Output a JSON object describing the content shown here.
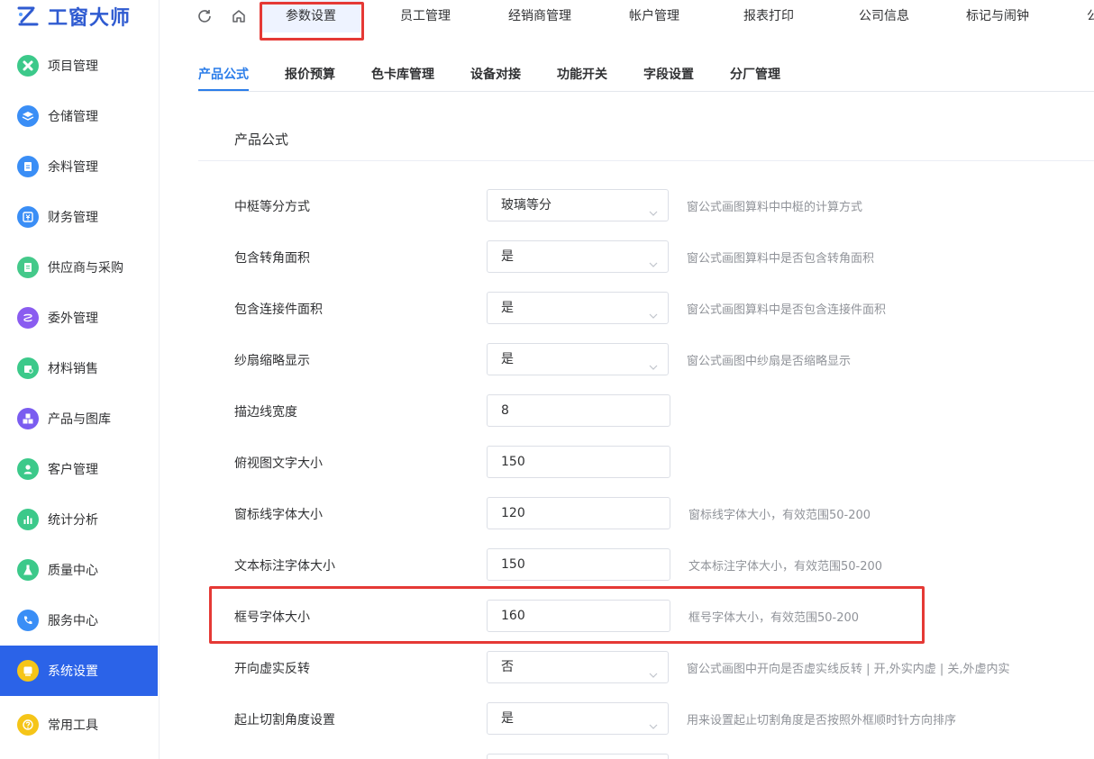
{
  "app": {
    "title": "工窗大师",
    "brand_color": "#2f5bd1",
    "accent_color": "#2b63e8",
    "highlight_color": "#e53935"
  },
  "sidebar": {
    "items": [
      {
        "label": "项目管理",
        "icon": "cross-icon",
        "color": "#3cc98a"
      },
      {
        "label": "仓储管理",
        "icon": "layers-icon",
        "color": "#3a8ef6"
      },
      {
        "label": "余料管理",
        "icon": "document-icon",
        "color": "#3a8ef6"
      },
      {
        "label": "财务管理",
        "icon": "yen-icon",
        "color": "#3a8ef6"
      },
      {
        "label": "供应商与采购",
        "icon": "list-icon",
        "color": "#44c98a"
      },
      {
        "label": "委外管理",
        "icon": "outsource-icon",
        "color": "#8a5cf0"
      },
      {
        "label": "材料销售",
        "icon": "shop-icon",
        "color": "#3cc98a"
      },
      {
        "label": "产品与图库",
        "icon": "boxes-icon",
        "color": "#7a5cf0"
      },
      {
        "label": "客户管理",
        "icon": "user-icon",
        "color": "#3cc98a"
      },
      {
        "label": "统计分析",
        "icon": "bar-chart-icon",
        "color": "#3cc98a"
      },
      {
        "label": "质量中心",
        "icon": "flask-icon",
        "color": "#3cc98a"
      },
      {
        "label": "服务中心",
        "icon": "phone-icon",
        "color": "#3a8ef6"
      },
      {
        "label": "系统设置",
        "icon": "settings-icon",
        "color": "#f5c518",
        "active": true
      },
      {
        "label": "常用工具",
        "icon": "question-icon",
        "color": "#f5c518"
      }
    ]
  },
  "topbar": {
    "refresh_icon": "refresh-icon",
    "home_icon": "home-icon",
    "tabs": [
      "参数设置",
      "员工管理",
      "经销商管理",
      "帐户管理",
      "报表打印",
      "公司信息",
      "标记与闹钟",
      "公"
    ],
    "active_index": 0
  },
  "subtabs": {
    "items": [
      "产品公式",
      "报价预算",
      "色卡库管理",
      "设备对接",
      "功能开关",
      "字段设置",
      "分厂管理"
    ],
    "active_index": 0
  },
  "section": {
    "title": "产品公式"
  },
  "rows": [
    {
      "label": "中梃等分方式",
      "type": "select",
      "value": "玻璃等分",
      "hint": "窗公式画图算料中中梃的计算方式"
    },
    {
      "label": "包含转角面积",
      "type": "select",
      "value": "是",
      "hint": "窗公式画图算料中是否包含转角面积"
    },
    {
      "label": "包含连接件面积",
      "type": "select",
      "value": "是",
      "hint": "窗公式画图算料中是否包含连接件面积"
    },
    {
      "label": "纱扇缩略显示",
      "type": "select",
      "value": "是",
      "hint": "窗公式画图中纱扇是否缩略显示"
    },
    {
      "label": "描边线宽度",
      "type": "input",
      "value": "8",
      "hint": ""
    },
    {
      "label": "俯视图文字大小",
      "type": "input",
      "value": "150",
      "hint": ""
    },
    {
      "label": "窗标线字体大小",
      "type": "input",
      "value": "120",
      "hint": "窗标线字体大小，有效范围50-200"
    },
    {
      "label": "文本标注字体大小",
      "type": "input",
      "value": "150",
      "hint": "文本标注字体大小，有效范围50-200"
    },
    {
      "label": "框号字体大小",
      "type": "input",
      "value": "160",
      "hint": "框号字体大小，有效范围50-200",
      "highlighted": true
    },
    {
      "label": "开向虚实反转",
      "type": "select",
      "value": "否",
      "hint": "窗公式画图中开向是否虚实线反转 | 开,外实内虚 | 关,外虚内实"
    },
    {
      "label": "起止切割角度设置",
      "type": "select",
      "value": "是",
      "hint": "用来设置起止切割角度是否按照外框顺时针方向排序"
    }
  ]
}
